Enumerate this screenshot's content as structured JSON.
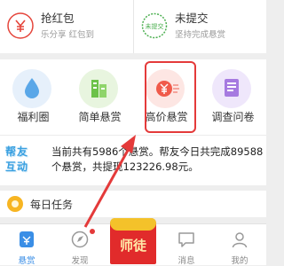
{
  "top_cards": [
    {
      "title": "抢红包",
      "subtitle": "乐分享 红包到",
      "icon": "red-envelope-icon",
      "color": "#e5453b"
    },
    {
      "title": "未提交",
      "subtitle": "坚持完成悬赏",
      "icon": "unsubmitted-stamp-icon",
      "color": "#4caf50",
      "stamp": "未提交"
    }
  ],
  "features": [
    {
      "label": "福利圈",
      "icon": "water-drop-icon",
      "color": "#5aa7e8"
    },
    {
      "label": "简单悬赏",
      "icon": "building-icon",
      "color": "#6cc24a"
    },
    {
      "label": "高价悬赏",
      "icon": "yen-coin-icon",
      "color": "#f05a4a"
    },
    {
      "label": "调查问卷",
      "icon": "questionnaire-icon",
      "color": "#a67ae0"
    }
  ],
  "news": {
    "badge_line1": "帮友",
    "badge_line2": "互动",
    "text": "当前共有5986个悬赏。帮友今日共完成89588个悬赏，共提现123226.98元。"
  },
  "daily_task": {
    "label": "每日任务"
  },
  "tabbar": {
    "tabs": [
      {
        "label": "悬赏",
        "icon": "reward-icon"
      },
      {
        "label": "发现",
        "icon": "discover-icon"
      },
      {
        "label": "消息",
        "icon": "message-icon"
      },
      {
        "label": "我的",
        "icon": "profile-icon"
      }
    ],
    "center_label": "师徒"
  }
}
